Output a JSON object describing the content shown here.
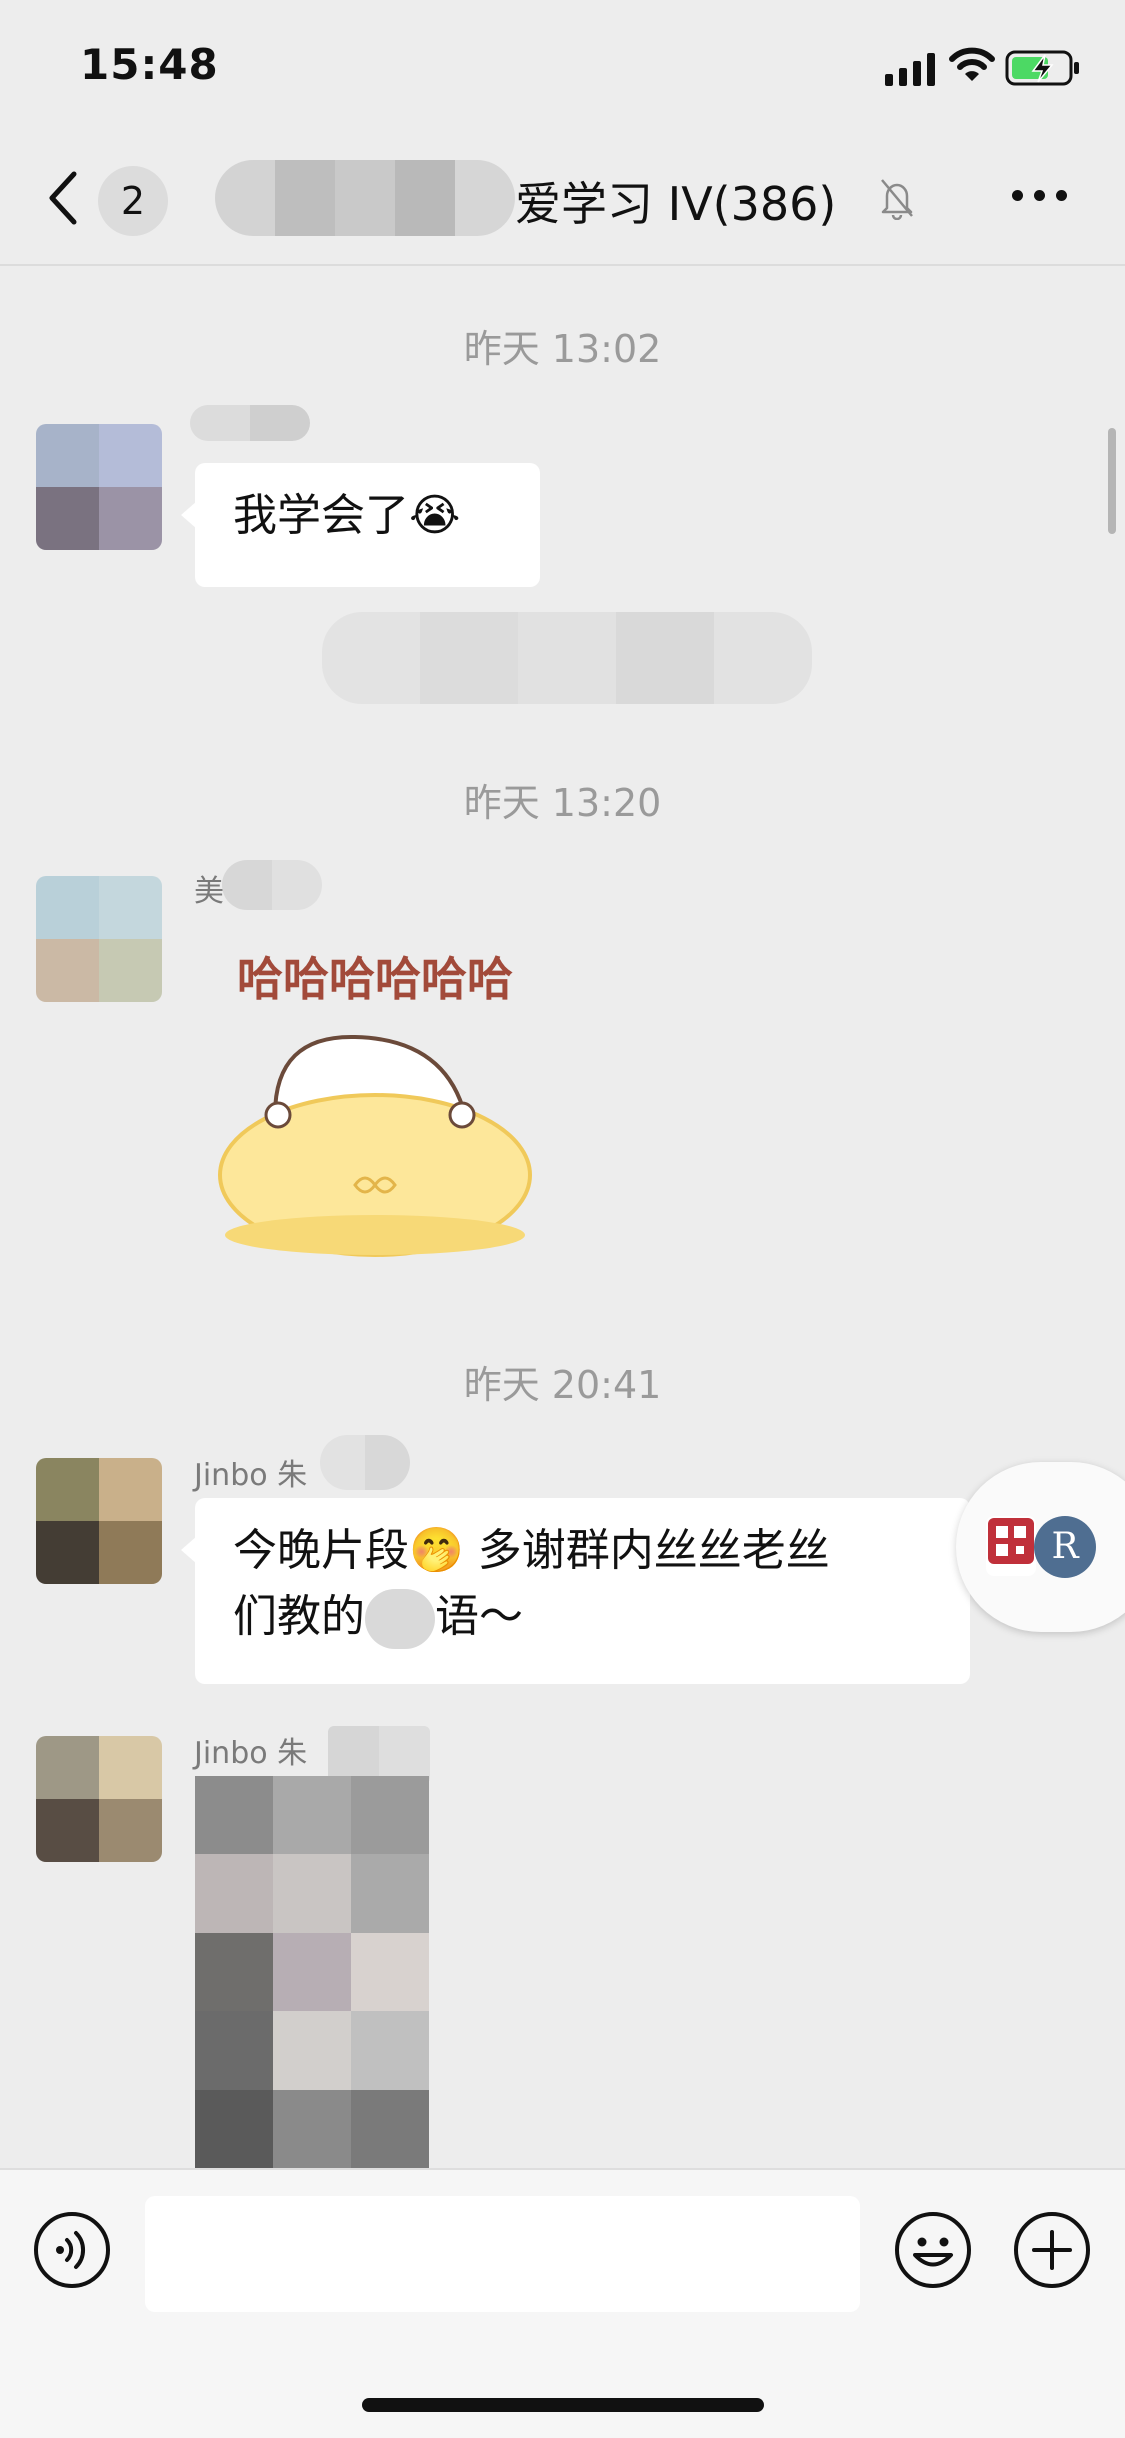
{
  "status_bar": {
    "time": "15:48"
  },
  "nav": {
    "unread_count": "2",
    "title": "爱学习 IV(386)"
  },
  "messages": [
    {
      "timestamp": "昨天 13:02",
      "sender": "",
      "text": "我学会了😭"
    },
    {
      "timestamp": "昨天 13:20",
      "sender": "美",
      "sticker_text": "哈哈哈哈哈哈"
    },
    {
      "timestamp": "昨天 20:41",
      "sender": "Jinbo 朱",
      "text_line1": "今晚片段🤭 多谢群内丝丝老丝",
      "text_line2": "们教的",
      "text_line2_end": "语～"
    },
    {
      "sender": "Jinbo 朱",
      "attachment": "image"
    }
  ],
  "floating_button": {
    "letter": "R"
  },
  "input_bar": {
    "placeholder": ""
  },
  "colors": {
    "background": "#ededed",
    "bubble": "#ffffff",
    "timestamp": "#9a9a9a",
    "float_accent": "#4f6e91",
    "battery_green": "#4cd964"
  }
}
